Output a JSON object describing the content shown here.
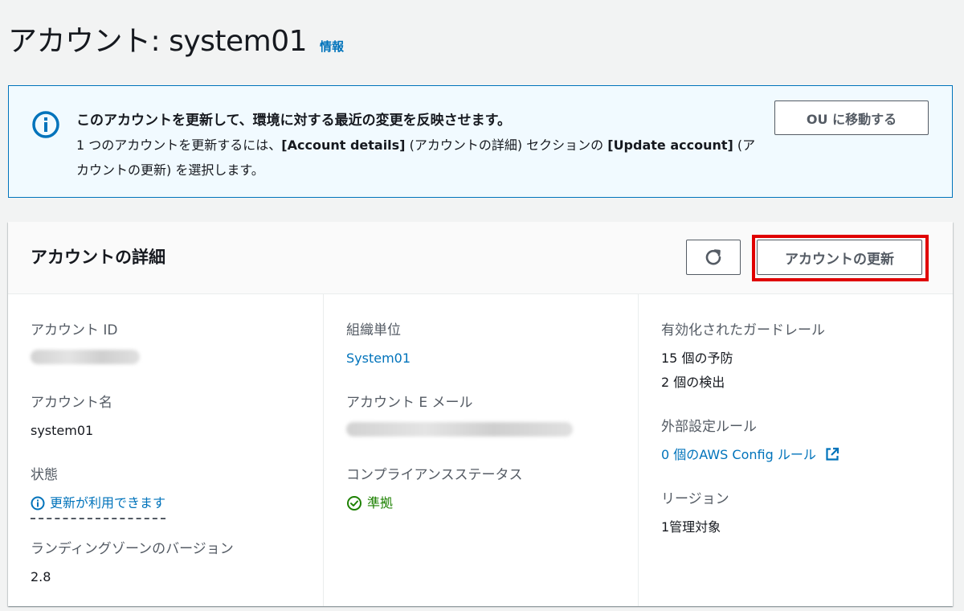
{
  "page": {
    "title": "アカウント: system01",
    "info_label": "情報"
  },
  "flash": {
    "title": "このアカウントを更新して、環境に対する最近の変更を反映させます。",
    "body_part1": "1 つのアカウントを更新するには、",
    "body_bold1": "[Account details]",
    "body_part2": " (アカウントの詳細) セクションの ",
    "body_bold2": "[Update account]",
    "body_part3": " (アカウントの更新) を選択します。",
    "button_label": "OU に移動する",
    "icon": "info-icon"
  },
  "panel": {
    "title": "アカウントの詳細",
    "refresh_icon": "refresh-icon",
    "update_button_label": "アカウントの更新",
    "highlight_color": "#e00000"
  },
  "details": {
    "account_id": {
      "label": "アカウント ID"
    },
    "account_name": {
      "label": "アカウント名",
      "value": "system01"
    },
    "state": {
      "label": "状態",
      "value": "更新が利用できます"
    },
    "landing_zone_version": {
      "label": "ランディングゾーンのバージョン",
      "value": "2.8"
    },
    "ou": {
      "label": "組織単位",
      "value": "System01"
    },
    "email": {
      "label": "アカウント E メール"
    },
    "compliance": {
      "label": "コンプライアンスステータス",
      "value": "準拠"
    },
    "guardrails": {
      "label": "有効化されたガードレール",
      "preventive": "15 個の予防",
      "detective": "2 個の検出"
    },
    "config_rules": {
      "label": "外部設定ルール",
      "value": "0 個のAWS Config ルール"
    },
    "regions": {
      "label": "リージョン",
      "value": "1管理対象"
    }
  },
  "colors": {
    "link": "#0073bb",
    "success": "#1d8102",
    "flash_bg": "#f1faff",
    "page_bg": "#f2f3f3"
  }
}
